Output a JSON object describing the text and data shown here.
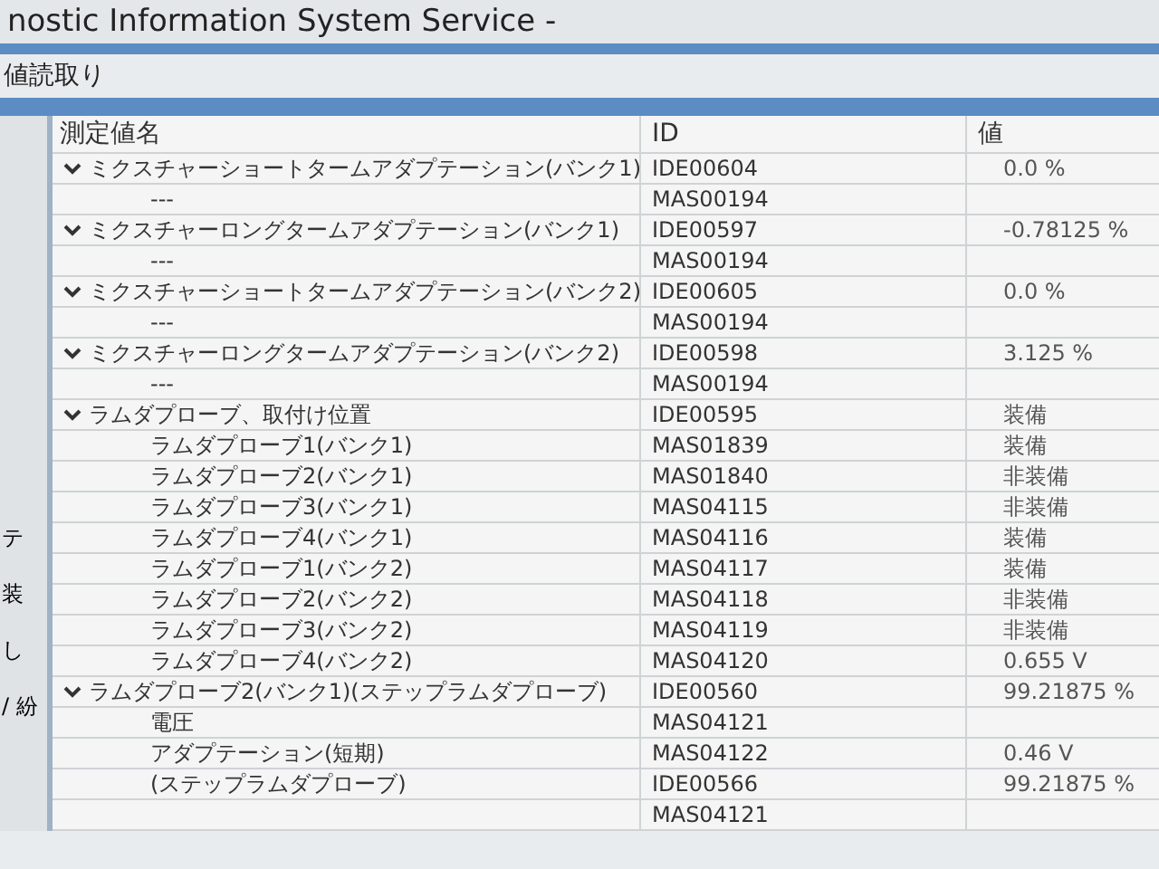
{
  "window": {
    "title": "nostic Information System Service -"
  },
  "panel": {
    "title": "値読取り"
  },
  "side_strip": [
    "テ",
    "装",
    "し",
    "/ 紛"
  ],
  "table": {
    "columns": [
      "測定値名",
      "ID",
      "値"
    ],
    "rows": [
      {
        "name": "ミクスチャーショートタームアダプテーション(バンク1)",
        "id": "IDE00604",
        "value": "0.0 %",
        "expanded": true,
        "children": [
          {
            "name": "---",
            "id": "MAS00194"
          }
        ]
      },
      {
        "name": "ミクスチャーロングタームアダプテーション(バンク1)",
        "id": "IDE00597",
        "value": "-0.78125 %",
        "expanded": true,
        "children": [
          {
            "name": "---",
            "id": "MAS00194"
          }
        ]
      },
      {
        "name": "ミクスチャーショートタームアダプテーション(バンク2)",
        "id": "IDE00605",
        "value": "0.0 %",
        "expanded": true,
        "children": [
          {
            "name": "---",
            "id": "MAS00194"
          }
        ]
      },
      {
        "name": "ミクスチャーロングタームアダプテーション(バンク2)",
        "id": "IDE00598",
        "value": "3.125 %",
        "expanded": true,
        "children": [
          {
            "name": "---",
            "id": "MAS00194"
          }
        ]
      },
      {
        "name": "ラムダプローブ、取付け位置",
        "id": "IDE00595",
        "value": "装備",
        "expanded": true,
        "children": [
          {
            "name": "ラムダプローブ1(バンク1)",
            "id": "MAS01839",
            "value": "装備"
          },
          {
            "name": "ラムダプローブ2(バンク1)",
            "id": "MAS01840",
            "value": "非装備"
          },
          {
            "name": "ラムダプローブ3(バンク1)",
            "id": "MAS04115",
            "value": "非装備"
          },
          {
            "name": "ラムダプローブ4(バンク1)",
            "id": "MAS04116",
            "value": "装備"
          },
          {
            "name": "ラムダプローブ1(バンク2)",
            "id": "MAS04117",
            "value": "装備"
          },
          {
            "name": "ラムダプローブ2(バンク2)",
            "id": "MAS04118",
            "value": "非装備"
          },
          {
            "name": "ラムダプローブ3(バンク2)",
            "id": "MAS04119",
            "value": "非装備"
          },
          {
            "name": "ラムダプローブ4(バンク2)",
            "id": "MAS04120",
            "value": "0.655 V"
          }
        ]
      },
      {
        "name": "ラムダプローブ2(バンク1)(ステップラムダプローブ)",
        "id": "IDE00560",
        "value": "99.21875 %",
        "expanded": true,
        "children": [
          {
            "name": "電圧",
            "id": "MAS04121"
          },
          {
            "name": "アダプテーション(短期)",
            "id": "MAS04122",
            "value": "0.46 V"
          },
          {
            "name": "(ステップラムダプローブ)",
            "id": "IDE00566",
            "value": "99.21875 %"
          },
          {
            "id": "MAS04121"
          }
        ]
      }
    ]
  }
}
